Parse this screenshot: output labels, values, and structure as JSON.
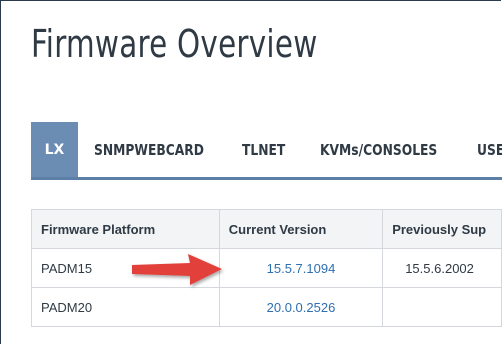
{
  "page": {
    "title": "Firmware Overview"
  },
  "tabs": [
    {
      "label": "LX",
      "active": true
    },
    {
      "label": "SNMPWEBCARD",
      "active": false
    },
    {
      "label": "TLNET",
      "active": false
    },
    {
      "label": "KVMs/CONSOLES",
      "active": false
    },
    {
      "label": "USE",
      "active": false
    }
  ],
  "table": {
    "headers": [
      "Firmware Platform",
      "Current Version",
      "Previously Sup"
    ],
    "rows": [
      {
        "platform": "PADM15",
        "current": "15.5.7.1094",
        "previous": "15.5.6.2002"
      },
      {
        "platform": "PADM20",
        "current": "20.0.0.2526",
        "previous": ""
      }
    ]
  },
  "colors": {
    "accent": "#6b8db3",
    "link": "#2e6fb0",
    "arrow": "#e2403a",
    "text": "#2f3a44"
  },
  "annotation": {
    "icon": "red-arrow-icon"
  }
}
